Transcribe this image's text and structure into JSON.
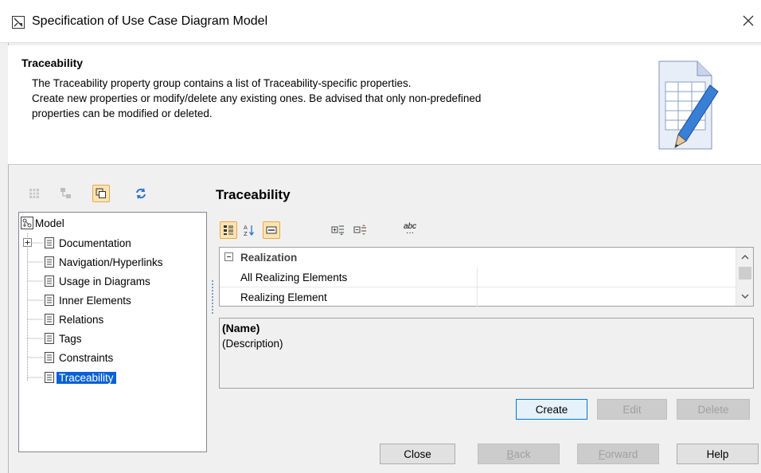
{
  "window": {
    "title": "Specification of Use Case Diagram Model",
    "close_glyph": "✕"
  },
  "header": {
    "title": "Traceability",
    "description_lines": [
      "The Traceability property group contains a list of Traceability-specific properties.",
      "Create new properties or modify/delete any existing ones. Be advised that only non-predefined",
      "properties can be modified or deleted."
    ],
    "illustration_icon": "table-document-pencil-icon"
  },
  "tree_toolbar": {
    "icons": [
      "table-view-icon",
      "tree-view-icon",
      "copy-window-icon",
      "refresh-icon"
    ],
    "active_index": 2
  },
  "tree": {
    "root_label": "Model",
    "items": [
      {
        "label": "Documentation",
        "expandable": true
      },
      {
        "label": "Navigation/Hyperlinks",
        "expandable": false
      },
      {
        "label": "Usage in Diagrams",
        "expandable": false
      },
      {
        "label": "Inner Elements",
        "expandable": false
      },
      {
        "label": "Relations",
        "expandable": false
      },
      {
        "label": "Tags",
        "expandable": false
      },
      {
        "label": "Constraints",
        "expandable": false
      },
      {
        "label": "Traceability",
        "expandable": false,
        "selected": true
      }
    ]
  },
  "panel": {
    "title": "Traceability",
    "toolbar_icons": [
      "categorized-view-icon",
      "sort-alphabetical-icon",
      "description-toggle-icon",
      "expand-all-icon",
      "collapse-all-icon",
      "show-abbreviations-icon"
    ],
    "toolbar_abc_label": "abc",
    "grid": {
      "group": "Realization",
      "rows": [
        {
          "name": "All Realizing Elements",
          "value": ""
        },
        {
          "name": "Realizing Element",
          "value": ""
        }
      ]
    },
    "description": {
      "name": "(Name)",
      "text": "(Description)"
    }
  },
  "action_buttons": {
    "create": "Create",
    "edit": "Edit",
    "delete": "Delete"
  },
  "dialog_buttons": {
    "close": "Close",
    "back_mnemonic": "B",
    "back_rest": "ack",
    "forward_mnemonic": "F",
    "forward_rest": "orward",
    "help": "Help"
  },
  "colors": {
    "selection": "#0a60d8",
    "active_toolbar": "#fce3b2",
    "primary_border": "#0078d7"
  }
}
